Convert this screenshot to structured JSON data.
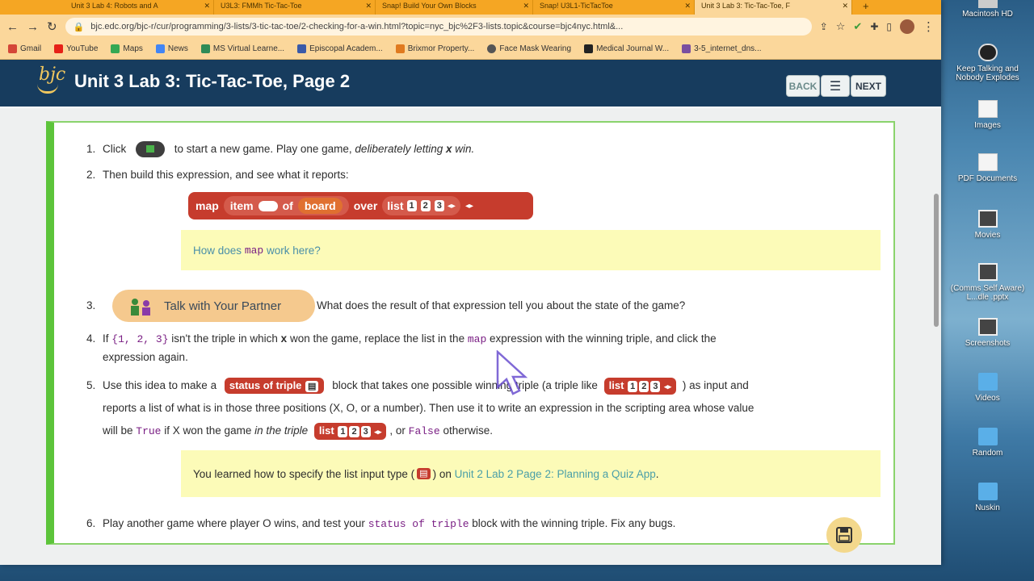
{
  "browser": {
    "tabs": [
      {
        "label": "Unit 3 Lab 4: Robots and A",
        "active": false
      },
      {
        "label": "U3L3: FMMh Tic-Tac-Toe",
        "active": false
      },
      {
        "label": "Snap! Build Your Own Blocks",
        "active": false
      },
      {
        "label": "Snap! U3L1-TicTacToe",
        "active": false
      },
      {
        "label": "Unit 3 Lab 3: Tic-Tac-Toe, F",
        "active": true
      }
    ],
    "url": "bjc.edc.org/bjc-r/cur/programming/3-lists/3-tic-tac-toe/2-checking-for-a-win.html?topic=nyc_bjc%2F3-lists.topic&course=bjc4nyc.html&...",
    "bookmarks": [
      "Gmail",
      "YouTube",
      "Maps",
      "News",
      "MS Virtual Learne...",
      "Episcopal Academ...",
      "Brixmor Property...",
      "Face Mask Wearing",
      "Medical Journal W...",
      "3-5_internet_dns..."
    ]
  },
  "site": {
    "logo_text": "bjc",
    "title": "Unit 3 Lab 3: Tic-Tac-Toe, Page 2",
    "back_label": "BACK",
    "next_label": "NEXT"
  },
  "steps": {
    "s1": {
      "num": "1.",
      "a": "Click",
      "b": "to start a new game. Play one game,",
      "c": "deliberately letting",
      "d": "x",
      "e": "win."
    },
    "s2": {
      "num": "2.",
      "text": "Then build this expression, and see what it reports:"
    },
    "map_block": {
      "map": "map",
      "item": "item",
      "of": "of",
      "board": "board",
      "over": "over",
      "list": "list",
      "n1": "1",
      "n2": "2",
      "n3": "3"
    },
    "callout1": {
      "a": "How does",
      "code": "map",
      "b": "work here?"
    },
    "talk": "Talk with Your Partner",
    "s3": {
      "num": "3.",
      "text": "What does the result of that expression tell you about the state of the game?"
    },
    "s4": {
      "num": "4.",
      "a": "If",
      "code1": "{1, 2, 3}",
      "b": "isn't the triple in which",
      "x": "x",
      "c": "won the game, replace the list in the",
      "code2": "map",
      "d": "expression with the winning triple, and click the",
      "e": "expression again."
    },
    "s5": {
      "num": "5.",
      "a": "Use this idea to make a",
      "block": "status of triple",
      "b": "block that takes one possible winning triple (a triple like",
      "list": "list",
      "c": ") as input and",
      "d": "reports a list of what is in those three positions (X, O, or a number). Then use it to write an expression in the scripting area whose value",
      "e": "will be",
      "true": "True",
      "f": "if X won the game",
      "g": "in the triple",
      "h": ", or",
      "false": "False",
      "i": "otherwise."
    },
    "callout2": {
      "a": "You learned how to specify the list input type (",
      "b": ") on",
      "link": "Unit 2 Lab 2 Page 2: Planning a Quiz App",
      "c": "."
    },
    "s6": {
      "num": "6.",
      "a": "Play another game where player O wins, and test your",
      "code": "status of triple",
      "b": "block with the winning triple. Fix any bugs."
    }
  },
  "desktop": {
    "items": [
      "Macintosh HD",
      "Keep Talking and Nobody Explodes",
      "Images",
      "PDF Documents",
      "Movies",
      "(Comms Self Aware) L...dle .pptx",
      "Screenshots",
      "Videos",
      "Random",
      "Nuskin"
    ]
  },
  "colors": {
    "accent": "#173c5e",
    "block_red": "#c63c2d",
    "panel_green": "#5cc43a",
    "tab_orange": "#f5a623"
  }
}
